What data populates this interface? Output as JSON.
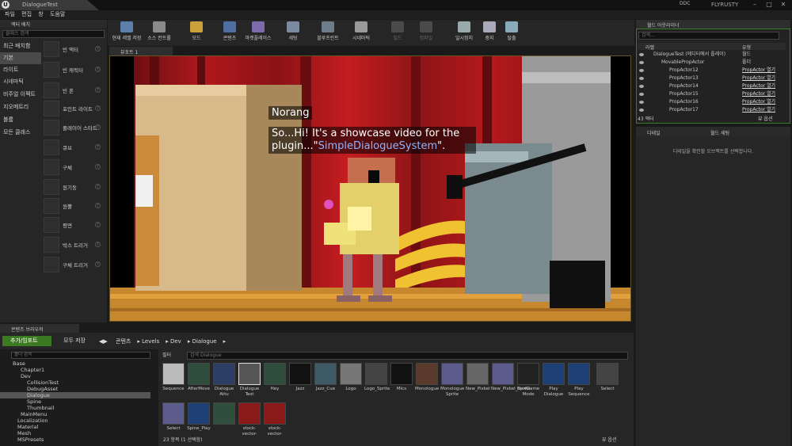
{
  "app": {
    "tab_title": "DialogueTest",
    "ddc": "DDC",
    "user": "FLYRUSTY"
  },
  "menu": [
    "파일",
    "편집",
    "창",
    "도움말"
  ],
  "place": {
    "tab": "액터 배치",
    "search_placeholder": "클래스 검색",
    "categories": [
      "최근 배치함",
      "기본",
      "라이트",
      "시네마틱",
      "비주얼 이펙트",
      "지오메트리",
      "볼륨",
      "모든 클래스"
    ],
    "actors": [
      "빈 액터",
      "빈 캐릭터",
      "빈 폰",
      "포인트 라이트",
      "플레이어 스타트",
      "큐브",
      "구체",
      "원기둥",
      "원뿔",
      "평면",
      "박스 트리거",
      "구체 트리거"
    ]
  },
  "toolbar": [
    "현재 레벨 저장",
    "소스 컨트롤",
    "모드",
    "콘텐츠",
    "마켓플레이스",
    "세팅",
    "블루프린트",
    "시네마틱",
    "빌드",
    "컴파일",
    "일시정지",
    "중지",
    "탈출"
  ],
  "viewport": {
    "tab": "뷰포트 1"
  },
  "dialogue": {
    "speaker": "Norang",
    "line_part1": "So...Hi! It's a showcase video for the plugin...\"",
    "line_highlight": "SimpleDialogueSystem",
    "line_part2": "\"."
  },
  "outliner": {
    "tab": "월드 아웃라이너",
    "search_placeholder": "검색...",
    "col_label": "라벨",
    "col_type": "유형",
    "rows": [
      {
        "name": "DialogueTest (에디터에서 플레이)",
        "type": "월드"
      },
      {
        "name": "MovablePropActor",
        "type": "폴더"
      },
      {
        "name": "PropActor12",
        "type": "PropActor 열기"
      },
      {
        "name": "PropActor13",
        "type": "PropActor 열기"
      },
      {
        "name": "PropActor14",
        "type": "PropActor 열기"
      },
      {
        "name": "PropActor15",
        "type": "PropActor 열기"
      },
      {
        "name": "PropActor16",
        "type": "PropActor 열기"
      },
      {
        "name": "PropActor17",
        "type": "PropActor 열기"
      }
    ],
    "count": "43 액터",
    "view": "뷰 옵션"
  },
  "details": {
    "tab1": "디테일",
    "tab2": "월드 세팅",
    "empty_msg": "디테일을 확인할 오브젝트를 선택합니다."
  },
  "content": {
    "tab": "콘텐츠 브라우저",
    "add_label": "추가/임포트",
    "save_label": "모두 저장",
    "crumbs": [
      "콘텐츠",
      "Levels",
      "Dev",
      "Dialogue"
    ],
    "folder_search": "폴더 검색",
    "folders": [
      "Base",
      "Chapter1",
      "Dev",
      "CollisionTest",
      "DebugAsset",
      "Dialogue",
      "Spine",
      "Thumbnail",
      "MainMenu",
      "Localization",
      "Material",
      "Mesh",
      "MSPresets"
    ],
    "filter": "필터",
    "asset_search": "검색 Dialogue",
    "assets": [
      "Sequence",
      "AfterMove",
      "Dialogue Attu",
      "Dialogue Test",
      "Hey",
      "Jazz",
      "Jazz_Cue",
      "Logo",
      "Logo_Sprite",
      "Mics",
      "Monologue",
      "Monologue Sprite",
      "New_Pixkel",
      "New_Pixkel_Sprite",
      "NewGame Mode",
      "Play Dialogue",
      "Play Sequence",
      "Select",
      "Select",
      "Spine_Play",
      "",
      "stock-vector-",
      "stock-vector-"
    ],
    "count": "23 항목 (1 선택함)",
    "view": "뷰 옵션"
  }
}
